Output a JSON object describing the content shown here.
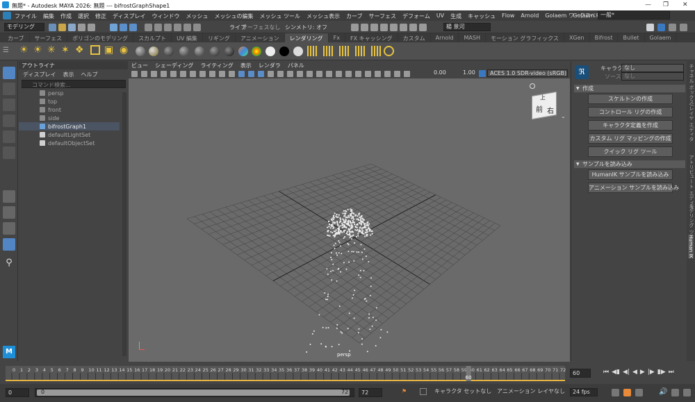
{
  "title": {
    "text": "無題* - Autodesk MAYA 2026: 無題 --- bifrostGraphShape1"
  },
  "menubar": {
    "items": [
      "ファイル",
      "編集",
      "作成",
      "選択",
      "修正",
      "ディスプレイ",
      "ウィンドウ",
      "メッシュ",
      "メッシュの編集",
      "メッシュ ツール",
      "メッシュ表示",
      "カーブ",
      "サーフェス",
      "デフォーム",
      "UV",
      "生成",
      "キャッシュ",
      "Flow",
      "Arnold",
      "Golaem",
      "Golaem Render",
      "ヘルプ"
    ],
    "workspace_label": "ワークスペース:",
    "workspace_value": "一般*"
  },
  "statusline": {
    "mode": "モデリング",
    "live": "ライブ",
    "live_value": "サーフェスなし",
    "symmetry": "シンメトリ: オフ",
    "user": "楊 景河"
  },
  "shelf_tabs": [
    "カーブ",
    "サーフェス",
    "ポリゴンのモデリング",
    "スカルプト",
    "UV 編集",
    "リギング",
    "アニメーション",
    "レンダリング",
    "Fx",
    "FX キャッシング",
    "カスタム",
    "Arnold",
    "MASH",
    "モーション グラフィックス",
    "XGen",
    "Bifrost",
    "Bullet",
    "Golaem"
  ],
  "shelf_active": "レンダリング",
  "outliner": {
    "tab": "アウトライナ",
    "menus": [
      "ディスプレイ",
      "表示",
      "ヘルプ"
    ],
    "search_placeholder": "コマンド検索...",
    "items": [
      {
        "label": "persp",
        "selected": false
      },
      {
        "label": "top",
        "selected": false
      },
      {
        "label": "front",
        "selected": false
      },
      {
        "label": "side",
        "selected": false
      },
      {
        "label": "bifrostGraph1",
        "selected": true
      },
      {
        "label": "defaultLightSet",
        "selected": false
      },
      {
        "label": "defaultObjectSet",
        "selected": false
      }
    ]
  },
  "viewport": {
    "menus": [
      "ビュー",
      "シェーディング",
      "ライティング",
      "表示",
      "レンダラ",
      "パネル"
    ],
    "field1": "0.00",
    "field2": "1.00",
    "colorspace": "ACES 1.0 SDR-video (sRGB)",
    "camera_label": "persp",
    "cube_top": "上",
    "cube_front": "前",
    "cube_right": "右"
  },
  "humanik": {
    "character_label": "キャラクタ:",
    "character_value": "なし",
    "source_label": "ソース:",
    "source_value": "なし",
    "sections": [
      {
        "title": "作成",
        "buttons": [
          "スケルトンの作成",
          "コントロール リグの作成",
          "キャラクタ定義を作成",
          "カスタム リグ マッピングの作成",
          "クイック リグ ツール"
        ]
      },
      {
        "title": "サンプルを読み込み",
        "buttons": [
          "HumanIK サンプルを読み込み",
          "アニメーション サンプルを読み込み"
        ]
      }
    ]
  },
  "right_tabs": [
    "チャネル ボックス/レイヤ エディタ",
    "アトリビュート エディタ",
    "モデリング ツールキット",
    "Human IK"
  ],
  "timeline": {
    "ticks": [
      0,
      1,
      2,
      3,
      4,
      5,
      6,
      7,
      8,
      9,
      10,
      11,
      12,
      13,
      14,
      15,
      16,
      17,
      18,
      19,
      20,
      21,
      22,
      23,
      24,
      25,
      26,
      27,
      28,
      29,
      30,
      31,
      32,
      33,
      34,
      35,
      36,
      37,
      38,
      39,
      40,
      41,
      42,
      43,
      44,
      45,
      46,
      47,
      48,
      49,
      50,
      51,
      52,
      53,
      54,
      55,
      56,
      57,
      58,
      59,
      60,
      61,
      62,
      63,
      64,
      65,
      66,
      67,
      68,
      69,
      70,
      71,
      72
    ],
    "current_frame": "60",
    "current_field": "60"
  },
  "range": {
    "start": "0",
    "inner_start": "0",
    "inner_end": "72",
    "end": "72",
    "character_set": "キャラクタ セットなし",
    "anim_layer": "アニメーション レイヤなし",
    "fps": "24 fps"
  },
  "colors": {
    "accent": "#1e8fd6",
    "selection": "#4a5463",
    "highlight": "#e8b640"
  }
}
